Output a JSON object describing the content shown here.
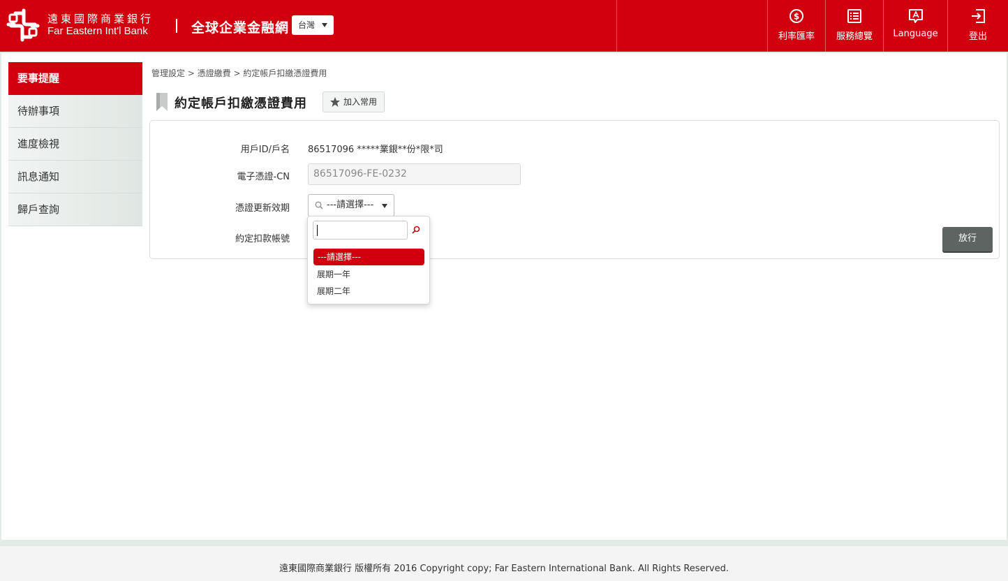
{
  "header": {
    "bank_name_zh": "遠東國際商業銀行",
    "bank_name_en": "Far Eastern Int'l Bank",
    "site_title": "全球企業金融網",
    "region": "台灣",
    "nav": [
      {
        "label": "利率匯率",
        "icon": "dollar-circle-icon"
      },
      {
        "label": "服務總覽",
        "icon": "list-icon"
      },
      {
        "label": "Language",
        "icon": "language-icon"
      },
      {
        "label": "登出",
        "icon": "logout-icon"
      }
    ],
    "brand_color": "#d0000e"
  },
  "sidebar": {
    "items": [
      {
        "label": "要事提醒",
        "active": true
      },
      {
        "label": "待辦事項",
        "active": false
      },
      {
        "label": "進度檢視",
        "active": false
      },
      {
        "label": "訊息通知",
        "active": false
      },
      {
        "label": "歸戶查詢",
        "active": false
      }
    ]
  },
  "main": {
    "breadcrumb": "管理設定 > 憑證繳費 > 約定帳戶扣繳憑證費用",
    "page_title": "約定帳戶扣繳憑證費用",
    "fav_label": "加入常用",
    "form": {
      "user_id_label": "用戶ID/戶名",
      "user_id_value": "86517096 *****業銀**份*限*司",
      "cert_cn_label": "電子憑證-CN",
      "cert_cn_value": "86517096-FE-0232",
      "renew_label": "憑證更新效期",
      "renew_selected": "---請選擇---",
      "account_label": "約定扣款帳號"
    },
    "release_label": "放行"
  },
  "dropdown": {
    "search_value": "",
    "options": [
      "---請選擇---",
      "展期一年",
      "展期二年"
    ],
    "selected_index": 0
  },
  "footer": {
    "copyright": "遠東國際商業銀行 版權所有 2016 Copyright copy; Far Eastern International Bank. All Rights Reserved."
  }
}
